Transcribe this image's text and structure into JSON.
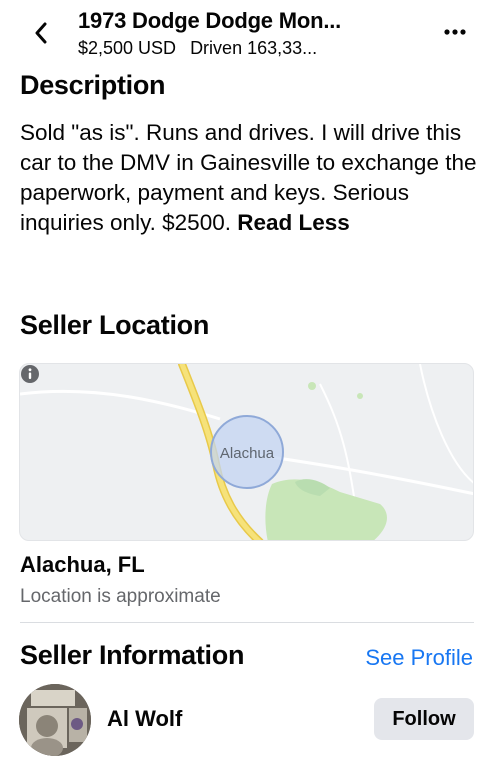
{
  "header": {
    "title": "1973 Dodge Dodge Mon...",
    "price": "$2,500 USD",
    "driven": "Driven 163,33...",
    "back_icon": "chevron-left-icon",
    "more_icon": "more-horizontal-icon"
  },
  "description": {
    "title": "Description",
    "text": "Sold \"as is\". Runs and drives. I will drive this car to the DMV in Gainesville to exchange the paperwork, payment and keys. Serious inquiries only. $2500.",
    "read_less": "Read Less"
  },
  "location": {
    "title": "Seller Location",
    "map_label": "Alachua",
    "city": "Alachua, FL",
    "approx_note": "Location is approximate",
    "info_icon": "info-icon"
  },
  "seller": {
    "title": "Seller Information",
    "see_profile": "See Profile",
    "name": "Al Wolf",
    "follow_label": "Follow"
  },
  "colors": {
    "link": "#1877f2",
    "secondary_text": "#65676b",
    "button_bg": "#e4e6eb",
    "map_bg": "#eef0f2",
    "map_road": "#f2d55c",
    "map_green": "#c8e6b8",
    "map_circle": "#a9c1ea"
  }
}
